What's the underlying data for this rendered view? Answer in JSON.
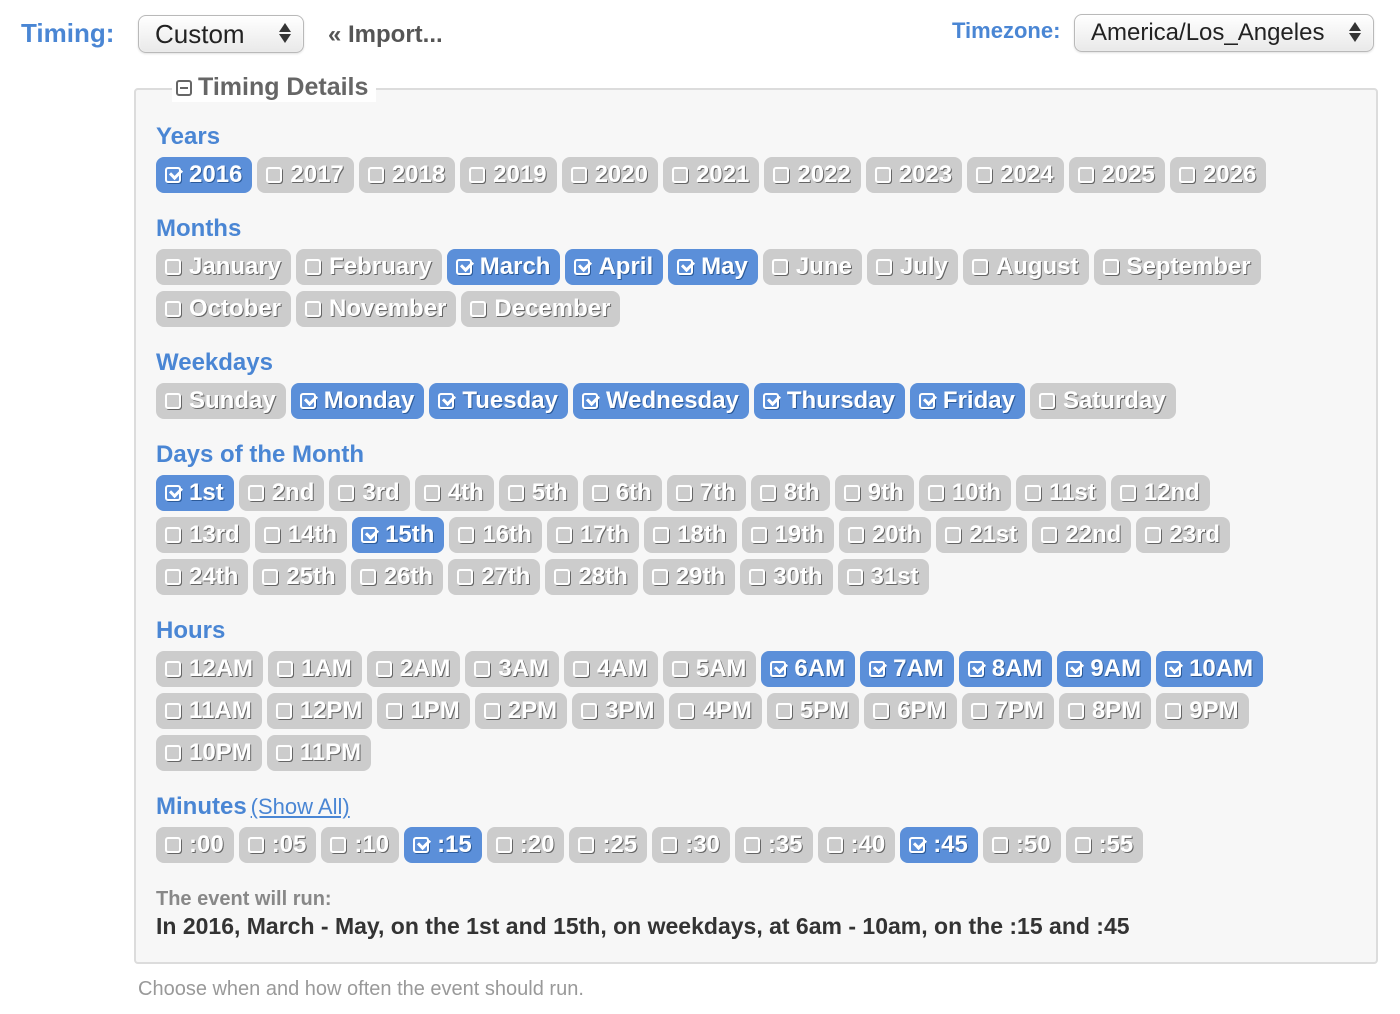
{
  "header": {
    "timing_label": "Timing:",
    "timing_value": "Custom",
    "import_link": "« Import...",
    "timezone_label": "Timezone:",
    "timezone_value": "America/Los_Angeles"
  },
  "details": {
    "legend": "Timing Details",
    "sections": {
      "years": {
        "title": "Years",
        "items": [
          {
            "label": "2016",
            "checked": true
          },
          {
            "label": "2017",
            "checked": false
          },
          {
            "label": "2018",
            "checked": false
          },
          {
            "label": "2019",
            "checked": false
          },
          {
            "label": "2020",
            "checked": false
          },
          {
            "label": "2021",
            "checked": false
          },
          {
            "label": "2022",
            "checked": false
          },
          {
            "label": "2023",
            "checked": false
          },
          {
            "label": "2024",
            "checked": false
          },
          {
            "label": "2025",
            "checked": false
          },
          {
            "label": "2026",
            "checked": false
          }
        ]
      },
      "months": {
        "title": "Months",
        "items": [
          {
            "label": "January",
            "checked": false
          },
          {
            "label": "February",
            "checked": false
          },
          {
            "label": "March",
            "checked": true
          },
          {
            "label": "April",
            "checked": true
          },
          {
            "label": "May",
            "checked": true
          },
          {
            "label": "June",
            "checked": false
          },
          {
            "label": "July",
            "checked": false
          },
          {
            "label": "August",
            "checked": false
          },
          {
            "label": "September",
            "checked": false
          },
          {
            "label": "October",
            "checked": false
          },
          {
            "label": "November",
            "checked": false
          },
          {
            "label": "December",
            "checked": false
          }
        ]
      },
      "weekdays": {
        "title": "Weekdays",
        "items": [
          {
            "label": "Sunday",
            "checked": false
          },
          {
            "label": "Monday",
            "checked": true
          },
          {
            "label": "Tuesday",
            "checked": true
          },
          {
            "label": "Wednesday",
            "checked": true
          },
          {
            "label": "Thursday",
            "checked": true
          },
          {
            "label": "Friday",
            "checked": true
          },
          {
            "label": "Saturday",
            "checked": false
          }
        ]
      },
      "days": {
        "title": "Days of the Month",
        "items": [
          {
            "label": "1st",
            "checked": true
          },
          {
            "label": "2nd",
            "checked": false
          },
          {
            "label": "3rd",
            "checked": false
          },
          {
            "label": "4th",
            "checked": false
          },
          {
            "label": "5th",
            "checked": false
          },
          {
            "label": "6th",
            "checked": false
          },
          {
            "label": "7th",
            "checked": false
          },
          {
            "label": "8th",
            "checked": false
          },
          {
            "label": "9th",
            "checked": false
          },
          {
            "label": "10th",
            "checked": false
          },
          {
            "label": "11st",
            "checked": false
          },
          {
            "label": "12nd",
            "checked": false
          },
          {
            "label": "13rd",
            "checked": false
          },
          {
            "label": "14th",
            "checked": false
          },
          {
            "label": "15th",
            "checked": true
          },
          {
            "label": "16th",
            "checked": false
          },
          {
            "label": "17th",
            "checked": false
          },
          {
            "label": "18th",
            "checked": false
          },
          {
            "label": "19th",
            "checked": false
          },
          {
            "label": "20th",
            "checked": false
          },
          {
            "label": "21st",
            "checked": false
          },
          {
            "label": "22nd",
            "checked": false
          },
          {
            "label": "23rd",
            "checked": false
          },
          {
            "label": "24th",
            "checked": false
          },
          {
            "label": "25th",
            "checked": false
          },
          {
            "label": "26th",
            "checked": false
          },
          {
            "label": "27th",
            "checked": false
          },
          {
            "label": "28th",
            "checked": false
          },
          {
            "label": "29th",
            "checked": false
          },
          {
            "label": "30th",
            "checked": false
          },
          {
            "label": "31st",
            "checked": false
          }
        ]
      },
      "hours": {
        "title": "Hours",
        "items": [
          {
            "label": "12AM",
            "checked": false
          },
          {
            "label": "1AM",
            "checked": false
          },
          {
            "label": "2AM",
            "checked": false
          },
          {
            "label": "3AM",
            "checked": false
          },
          {
            "label": "4AM",
            "checked": false
          },
          {
            "label": "5AM",
            "checked": false
          },
          {
            "label": "6AM",
            "checked": true
          },
          {
            "label": "7AM",
            "checked": true
          },
          {
            "label": "8AM",
            "checked": true
          },
          {
            "label": "9AM",
            "checked": true
          },
          {
            "label": "10AM",
            "checked": true
          },
          {
            "label": "11AM",
            "checked": false
          },
          {
            "label": "12PM",
            "checked": false
          },
          {
            "label": "1PM",
            "checked": false
          },
          {
            "label": "2PM",
            "checked": false
          },
          {
            "label": "3PM",
            "checked": false
          },
          {
            "label": "4PM",
            "checked": false
          },
          {
            "label": "5PM",
            "checked": false
          },
          {
            "label": "6PM",
            "checked": false
          },
          {
            "label": "7PM",
            "checked": false
          },
          {
            "label": "8PM",
            "checked": false
          },
          {
            "label": "9PM",
            "checked": false
          },
          {
            "label": "10PM",
            "checked": false
          },
          {
            "label": "11PM",
            "checked": false
          }
        ]
      },
      "minutes": {
        "title": "Minutes",
        "show_all_link": "(Show All)",
        "items": [
          {
            "label": ":00",
            "checked": false
          },
          {
            "label": ":05",
            "checked": false
          },
          {
            "label": ":10",
            "checked": false
          },
          {
            "label": ":15",
            "checked": true
          },
          {
            "label": ":20",
            "checked": false
          },
          {
            "label": ":25",
            "checked": false
          },
          {
            "label": ":30",
            "checked": false
          },
          {
            "label": ":35",
            "checked": false
          },
          {
            "label": ":40",
            "checked": false
          },
          {
            "label": ":45",
            "checked": true
          },
          {
            "label": ":50",
            "checked": false
          },
          {
            "label": ":55",
            "checked": false
          }
        ]
      }
    },
    "summary_label": "The event will run:",
    "summary_text": "In 2016, March - May, on the 1st and 15th, on weekdays, at 6am - 10am, on the :15 and :45"
  },
  "help_text": "Choose when and how often the event should run.",
  "colors": {
    "accent": "#4a86d4",
    "chip_checked": "#5b8fd9",
    "chip_unchecked": "#cccccc"
  }
}
